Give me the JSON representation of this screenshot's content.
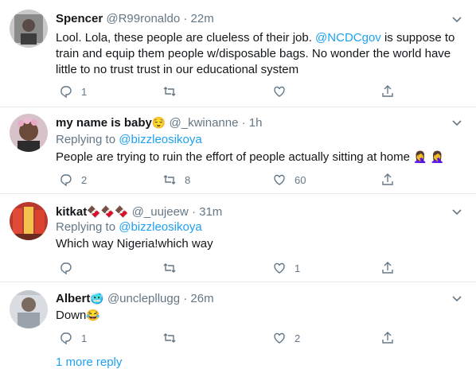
{
  "tweets": [
    {
      "name": "Spencer",
      "handle": "@R99ronaldo",
      "time": "22m",
      "body_plain": "Lool. Lola, these people are clueless of their job. ",
      "body_mention": "@NCDCgov",
      "body_rest": " is suppose to train and equip them people w/disposable bags. No wonder the world have little to no trust trust in our educational system",
      "replies": "1",
      "retweets": "",
      "likes": ""
    },
    {
      "name": "my name is baby",
      "name_emoji": "😌",
      "handle": "@_kwinanne",
      "time": "1h",
      "replying_prefix": "Replying to ",
      "replying_to": "@bizzleosikoya",
      "body": "People are trying to ruin the effort of people actually sitting at home",
      "body_emoji": "🤦‍♀️ 🤦‍♀️",
      "replies": "2",
      "retweets": "8",
      "likes": "60"
    },
    {
      "name": "kitkat",
      "name_emoji": "🍫🍫🍫",
      "handle": "@_uujeew",
      "time": "31m",
      "replying_prefix": "Replying to ",
      "replying_to": "@bizzleosikoya",
      "body": "Which way Nigeria!which way",
      "replies": "",
      "retweets": "",
      "likes": "1"
    },
    {
      "name": "Albert",
      "name_emoji": "🥶",
      "handle": "@unclepllugg",
      "time": "26m",
      "body": "Down",
      "body_emoji": "😂",
      "replies": "1",
      "retweets": "",
      "likes": "2"
    }
  ],
  "separator": "·",
  "more_replies": "1 more reply"
}
